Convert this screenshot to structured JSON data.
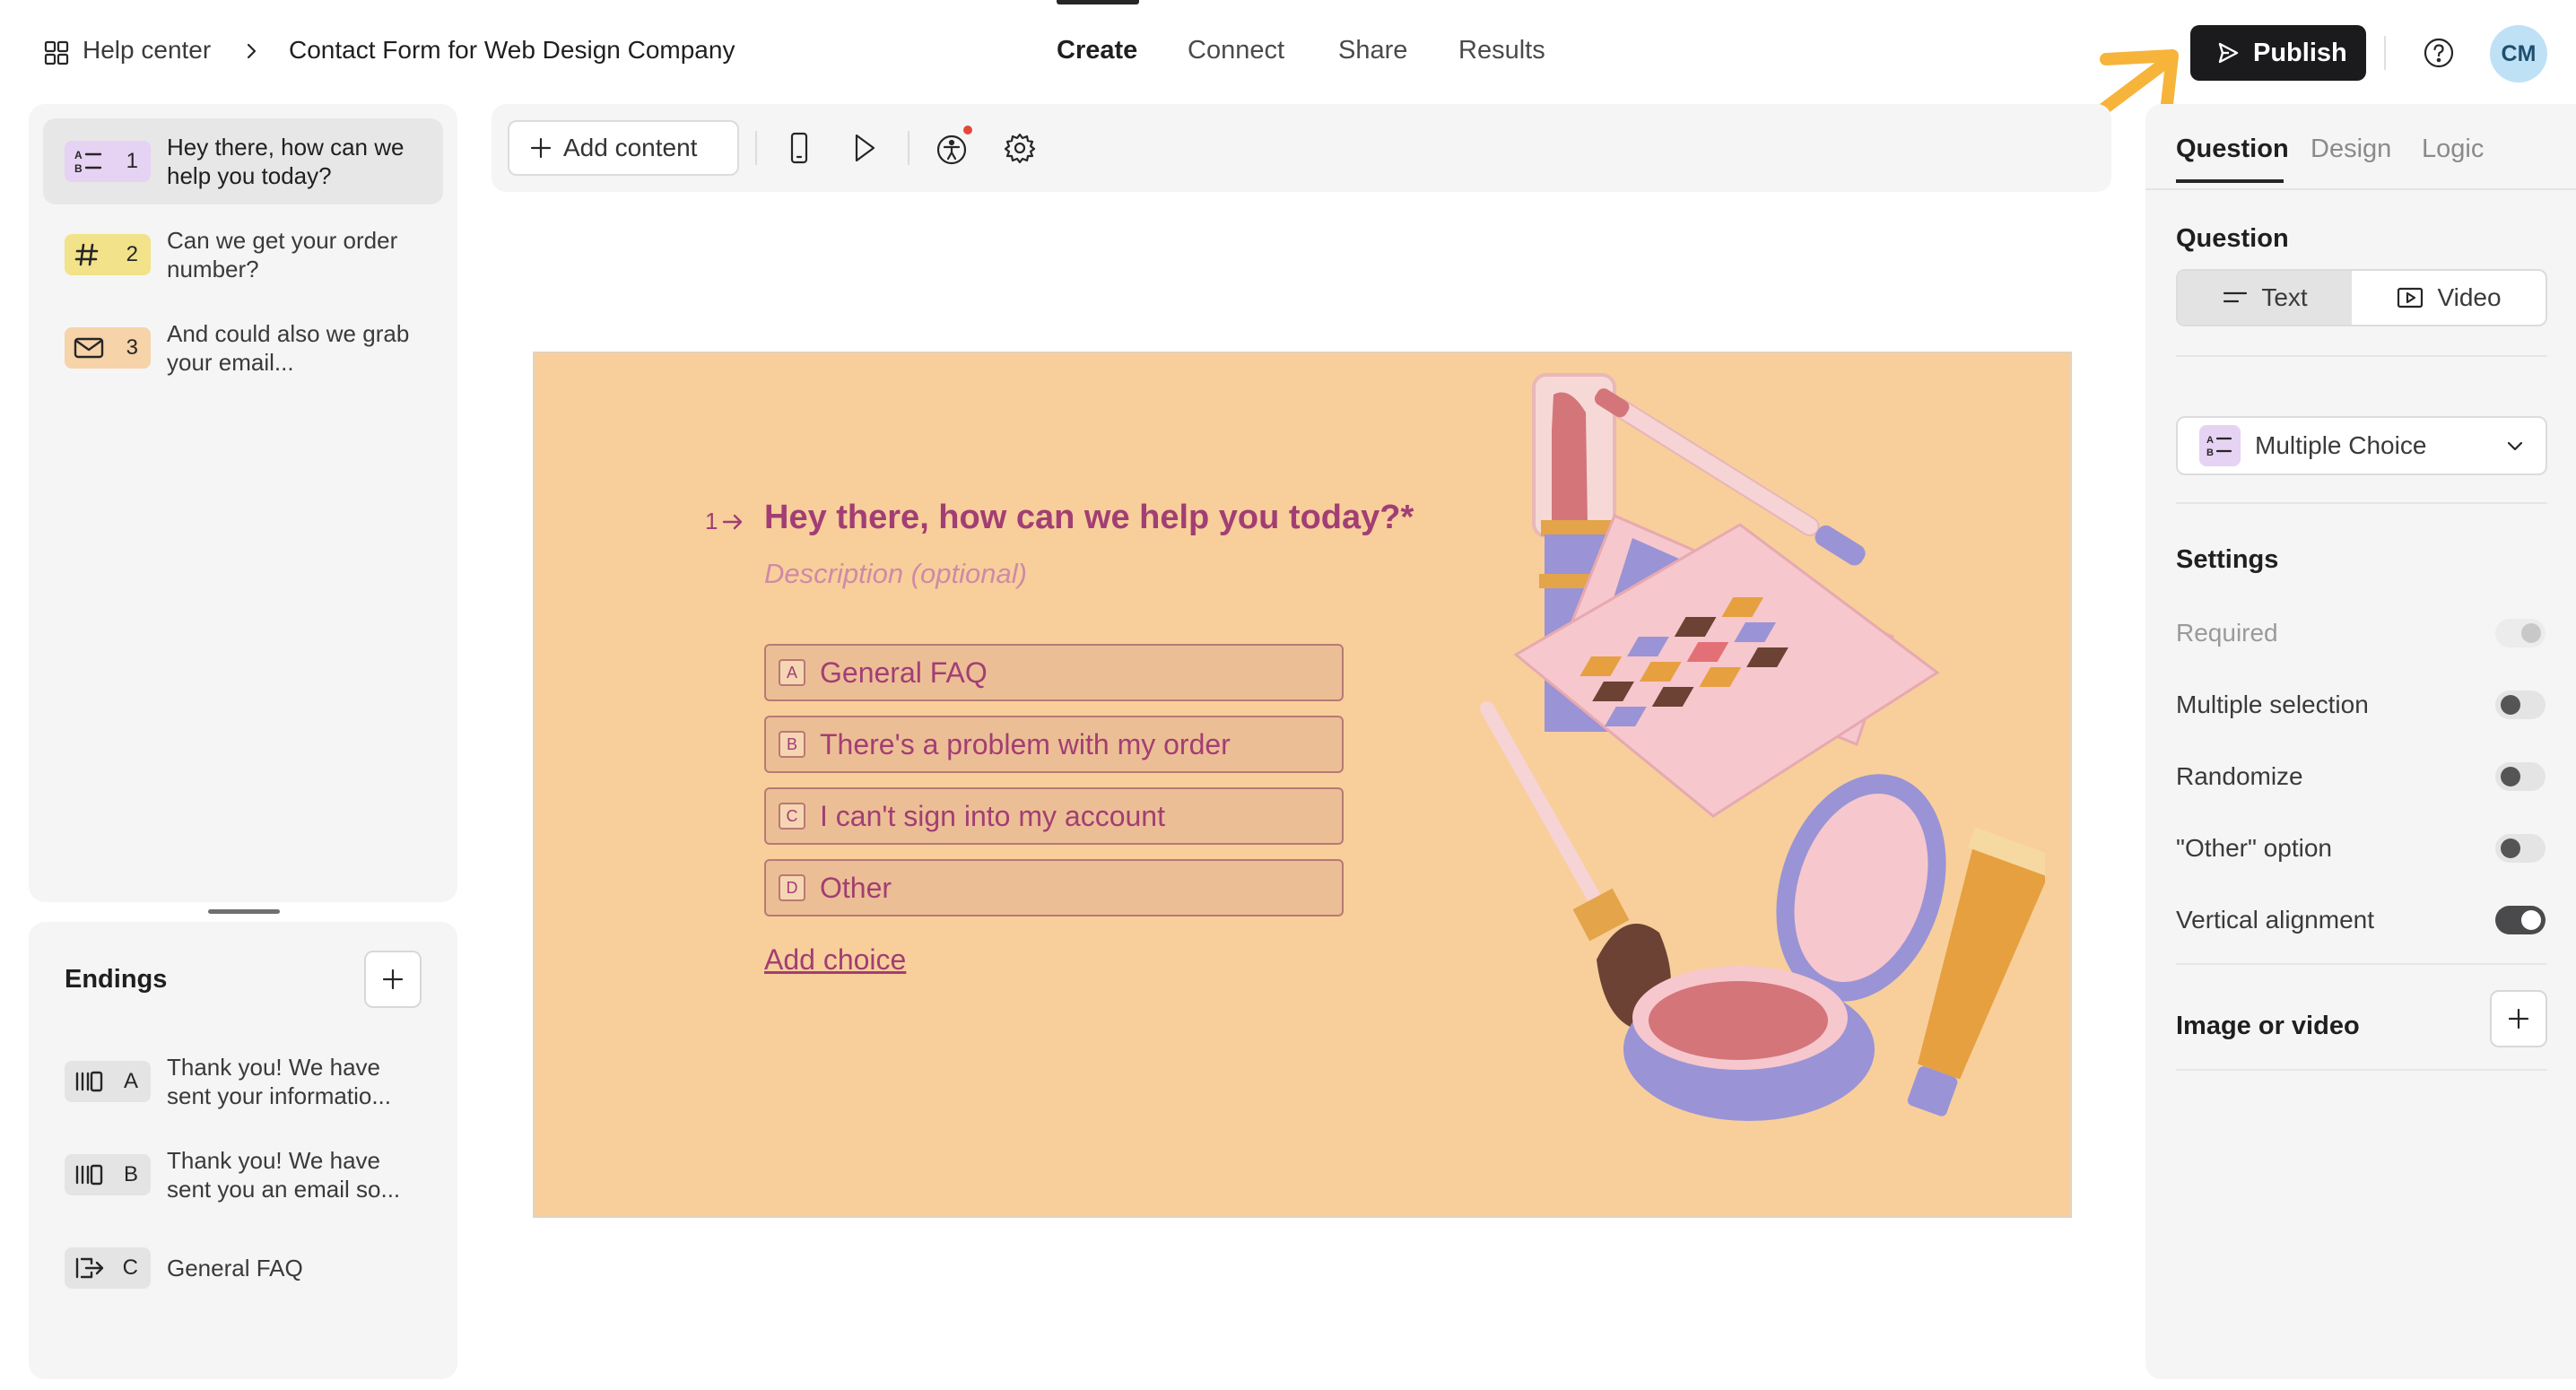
{
  "header": {
    "help_center": "Help center",
    "form_title": "Contact Form for Web Design Company",
    "tabs": [
      "Create",
      "Connect",
      "Share",
      "Results"
    ],
    "active_tab": "Create",
    "publish_label": "Publish",
    "avatar_initials": "CM"
  },
  "questions": [
    {
      "number": "1",
      "icon": "multiple-choice-icon",
      "color": "#e6d2f3",
      "text": "Hey there, how can we help you today?"
    },
    {
      "number": "2",
      "icon": "hash-icon",
      "color": "#f2e28a",
      "text": "Can we get your order number?"
    },
    {
      "number": "3",
      "icon": "mail-icon",
      "color": "#f6d3a8",
      "text": "And could also we grab your email..."
    }
  ],
  "endings": {
    "title": "Endings",
    "items": [
      {
        "key": "A",
        "icon": "ending-icon",
        "text": "Thank you! We have sent your informatio..."
      },
      {
        "key": "B",
        "icon": "ending-icon",
        "text": "Thank you! We have sent you an email so..."
      },
      {
        "key": "C",
        "icon": "redirect-icon",
        "text": "General FAQ"
      }
    ]
  },
  "toolbar": {
    "add_content": "Add content"
  },
  "canvas": {
    "question_number": "1",
    "question_title": "Hey there, how can we help you today?*",
    "description_placeholder": "Description (optional)",
    "choices": [
      {
        "key": "A",
        "label": "General FAQ"
      },
      {
        "key": "B",
        "label": "There's a problem with my order"
      },
      {
        "key": "C",
        "label": "I can't sign into my account"
      },
      {
        "key": "D",
        "label": "Other"
      }
    ],
    "add_choice": "Add choice",
    "background_color": "#f8cf9b",
    "accent_color": "#a23e74"
  },
  "right_panel": {
    "tabs": [
      "Question",
      "Design",
      "Logic"
    ],
    "active_tab": "Question",
    "question_label": "Question",
    "format_options": [
      "Text",
      "Video"
    ],
    "selected_format": "Text",
    "question_type": "Multiple Choice",
    "settings_label": "Settings",
    "settings": [
      {
        "label": "Required",
        "on": true,
        "disabled": true
      },
      {
        "label": "Multiple selection",
        "on": false
      },
      {
        "label": "Randomize",
        "on": false
      },
      {
        "label": "\"Other\" option",
        "on": false
      },
      {
        "label": "Vertical alignment",
        "on": true
      }
    ],
    "image_or_video": "Image or video"
  },
  "annotation": {
    "arrow_color": "#f6b43b"
  }
}
